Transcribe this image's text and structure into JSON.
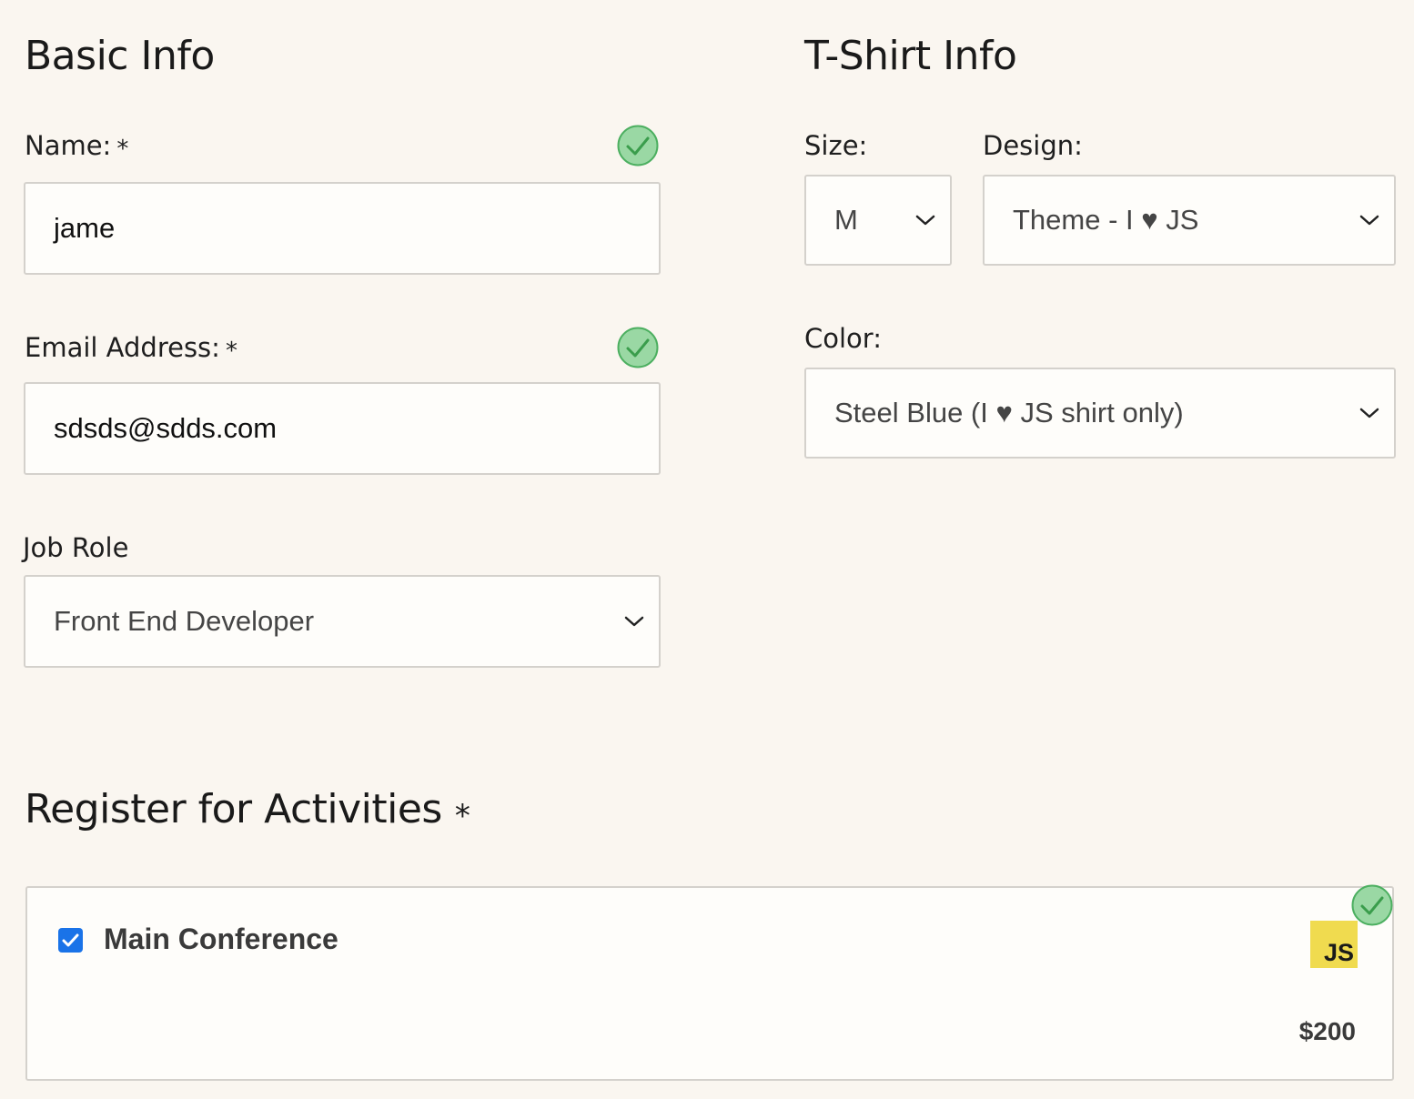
{
  "basic_info": {
    "heading": "Basic Info",
    "name": {
      "label": "Name:",
      "required_mark": "*",
      "value": "jame",
      "valid": true
    },
    "email": {
      "label": "Email Address:",
      "required_mark": "*",
      "value": "sdsds@sdds.com",
      "valid": true
    },
    "job_role": {
      "label": "Job Role",
      "selected": "Front End Developer"
    }
  },
  "tshirt_info": {
    "heading": "T-Shirt Info",
    "size": {
      "label": "Size:",
      "selected": "M"
    },
    "design": {
      "label": "Design:",
      "selected": "Theme - I ♥ JS"
    },
    "color": {
      "label": "Color:",
      "selected": "Steel Blue (I ♥ JS shirt only)"
    }
  },
  "activities": {
    "heading": "Register for Activities",
    "required_mark": "*",
    "valid": true,
    "items": [
      {
        "name": "Main Conference",
        "checked": true,
        "logo_text": "JS",
        "price": "$200"
      }
    ]
  },
  "colors": {
    "background": "#faf6f0",
    "valid_green": "#9ad8a4",
    "valid_green_stroke": "#4caf60",
    "checkbox_blue": "#1a73e8",
    "js_yellow": "#f0db4f"
  }
}
